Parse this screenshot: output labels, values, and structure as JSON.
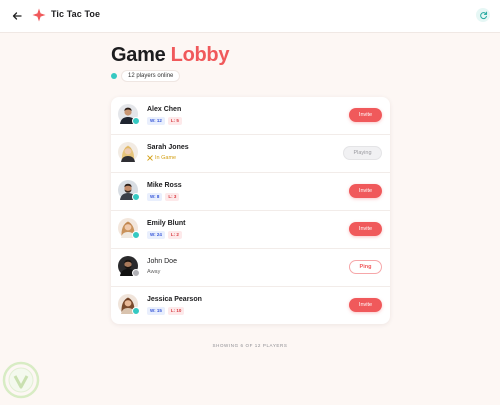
{
  "header": {
    "brand": "Tic Tac Toe",
    "back_icon": "arrow-left-icon",
    "logo_icon": "sparkle-icon",
    "refresh_icon": "refresh-icon"
  },
  "page": {
    "title_main": "Game",
    "title_accent": "Lobby",
    "online_text": "12 players online"
  },
  "players": [
    {
      "name": "Alex Chen",
      "wins": "W: 12",
      "losses": "L: 5",
      "action": "Invite"
    },
    {
      "name": "Sarah Jones",
      "status_text": "In Game",
      "action": "Playing"
    },
    {
      "name": "Mike Ross",
      "wins": "W: 8",
      "losses": "L: 3",
      "action": "Invite"
    },
    {
      "name": "Emily Blunt",
      "wins": "W: 24",
      "losses": "L: 2",
      "action": "Invite"
    },
    {
      "name": "John Doe",
      "status_text": "Away",
      "action": "Ping"
    },
    {
      "name": "Jessica Pearson",
      "wins": "W: 15",
      "losses": "L: 10",
      "action": "Invite"
    }
  ],
  "footer": "SHOWING 6 OF 12 PLAYERS",
  "colors": {
    "accent": "#f0595b",
    "online": "#35c9c2",
    "in_game": "#d4a017",
    "away": "#b0b0b5",
    "background": "#fdf7f4"
  }
}
